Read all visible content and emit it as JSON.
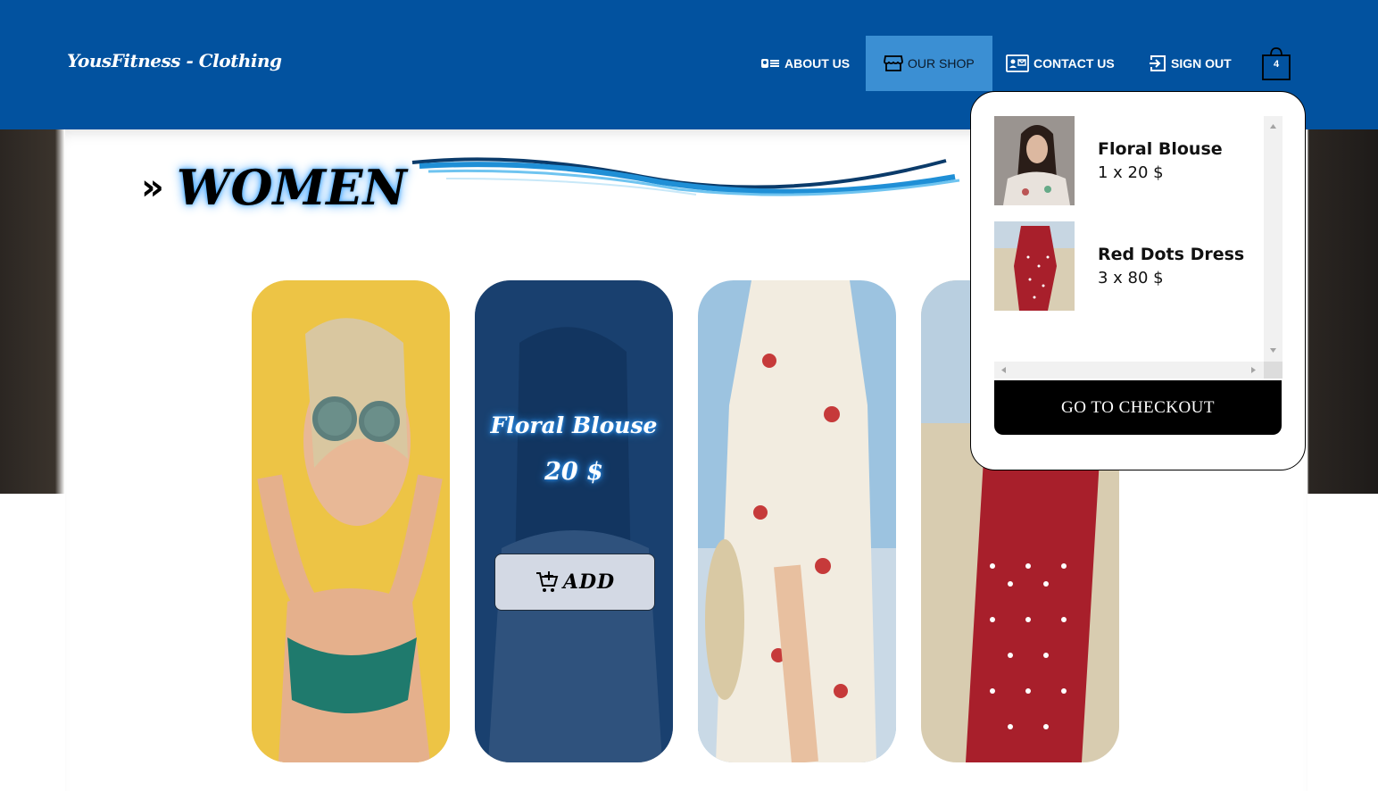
{
  "brand": "YousFitness - Clothing",
  "nav": {
    "items": [
      {
        "label": "ABOUT US"
      },
      {
        "label": "OUR SHOP"
      },
      {
        "label": "CONTACT US"
      },
      {
        "label": "SIGN OUT"
      }
    ],
    "cart_count": "4"
  },
  "section": {
    "prefix": "»",
    "title": "WOMEN"
  },
  "products": {
    "hovered": {
      "name": "Floral Blouse",
      "price": "20 $"
    },
    "add_label": "ADD"
  },
  "cart": {
    "items": [
      {
        "name": "Floral Blouse",
        "qty": "1 x 20 $"
      },
      {
        "name": "Red Dots Dress",
        "qty": "3 x 80 $"
      }
    ],
    "checkout_label": "GO TO CHECKOUT"
  },
  "colors": {
    "navbar": "#02529f",
    "nav_active": "#3b8fd3",
    "overlay": "#0a376e",
    "checkout": "#000000"
  }
}
